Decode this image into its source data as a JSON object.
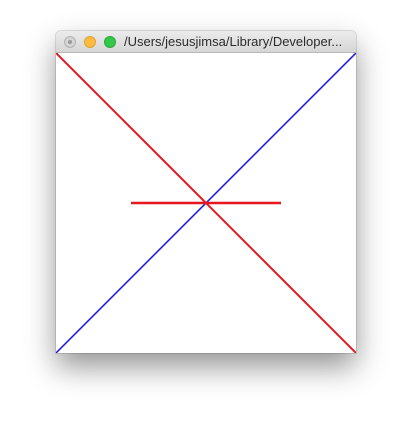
{
  "window": {
    "title": "/Users/jesusjimsa/Library/Developer..."
  },
  "canvas": {
    "background": "#ffffff",
    "lines": [
      {
        "name": "red-diagonal-line",
        "color": "#e8161e"
      },
      {
        "name": "blue-diagonal-line",
        "color": "#2020e0"
      },
      {
        "name": "red-horizontal-line",
        "color": "#e8161e"
      }
    ]
  }
}
